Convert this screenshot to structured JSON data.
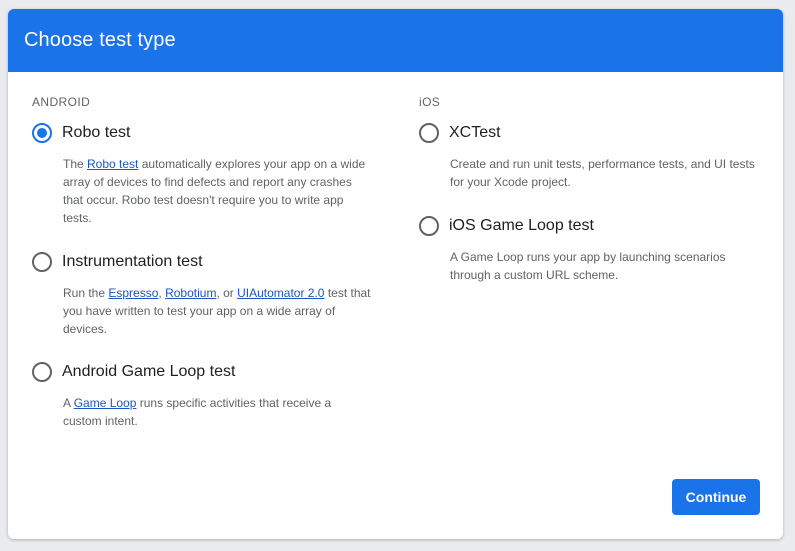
{
  "dialog": {
    "title": "Choose test type",
    "continue_label": "Continue"
  },
  "android": {
    "section_label": "ANDROID",
    "options": [
      {
        "label": "Robo test",
        "selected": true,
        "desc_pre": "The ",
        "link1": "Robo test",
        "desc_post": " automatically explores your app on a wide array of devices to find defects and report any crashes that occur. Robo test doesn't require you to write app tests."
      },
      {
        "label": "Instrumentation test",
        "selected": false,
        "desc_pre": "Run the ",
        "link1": "Espresso",
        "sep1": ", ",
        "link2": "Robotium",
        "sep2": ", or ",
        "link3": "UIAutomator 2.0",
        "desc_post": " test that you have written to test your app on a wide array of devices."
      },
      {
        "label": "Android Game Loop test",
        "selected": false,
        "desc_pre": "A ",
        "link1": "Game Loop",
        "desc_post": " runs specific activities that receive a custom intent."
      }
    ]
  },
  "ios": {
    "section_label": "iOS",
    "options": [
      {
        "label": "XCTest",
        "selected": false,
        "desc": "Create and run unit tests, performance tests, and UI tests for your Xcode project."
      },
      {
        "label": "iOS Game Loop test",
        "selected": false,
        "desc": "A Game Loop runs your app by launching scenarios through a custom URL scheme."
      }
    ]
  },
  "colors": {
    "accent": "#1a73e8",
    "link": "#1a56c2",
    "secondary_text": "#5f6368"
  }
}
